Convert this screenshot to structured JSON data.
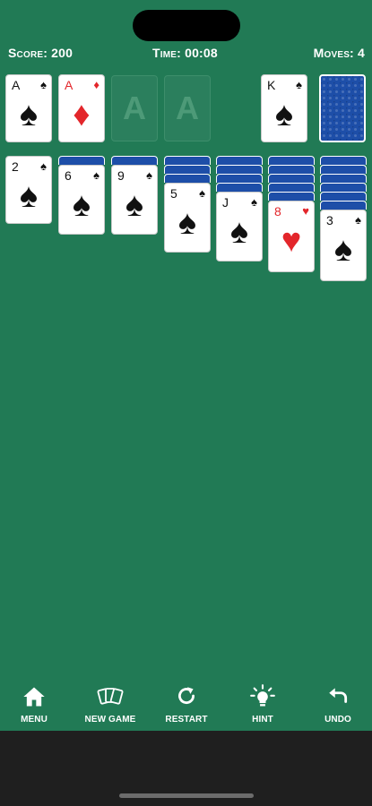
{
  "header": {
    "score": "Score: 200",
    "time": "Time: 00:08",
    "moves": "Moves: 4"
  },
  "foundations": [
    {
      "rank": "A",
      "suit": "♠",
      "color": "black"
    },
    {
      "rank": "A",
      "suit": "♦",
      "color": "red"
    },
    {
      "placeholder": "A"
    },
    {
      "placeholder": "A"
    }
  ],
  "waste": {
    "rank": "K",
    "suit": "♠",
    "color": "black"
  },
  "stock": {
    "icon": "card-back"
  },
  "tableau": [
    {
      "hidden": 0,
      "rank": "2",
      "suit": "♠",
      "color": "black"
    },
    {
      "hidden": 1,
      "rank": "6",
      "suit": "♠",
      "color": "black"
    },
    {
      "hidden": 1,
      "rank": "9",
      "suit": "♠",
      "color": "black"
    },
    {
      "hidden": 3,
      "rank": "5",
      "suit": "♠",
      "color": "black"
    },
    {
      "hidden": 4,
      "rank": "J",
      "suit": "♠",
      "color": "black"
    },
    {
      "hidden": 5,
      "rank": "8",
      "suit": "♥",
      "color": "red"
    },
    {
      "hidden": 6,
      "rank": "3",
      "suit": "♠",
      "color": "black"
    }
  ],
  "toolbar": {
    "menu": "MENU",
    "new_game": "NEW GAME",
    "restart": "RESTART",
    "hint": "HINT",
    "undo": "UNDO"
  },
  "colors": {
    "felt": "#217a55",
    "card_back": "#1d4ea8",
    "red_suit": "#e3262b"
  }
}
